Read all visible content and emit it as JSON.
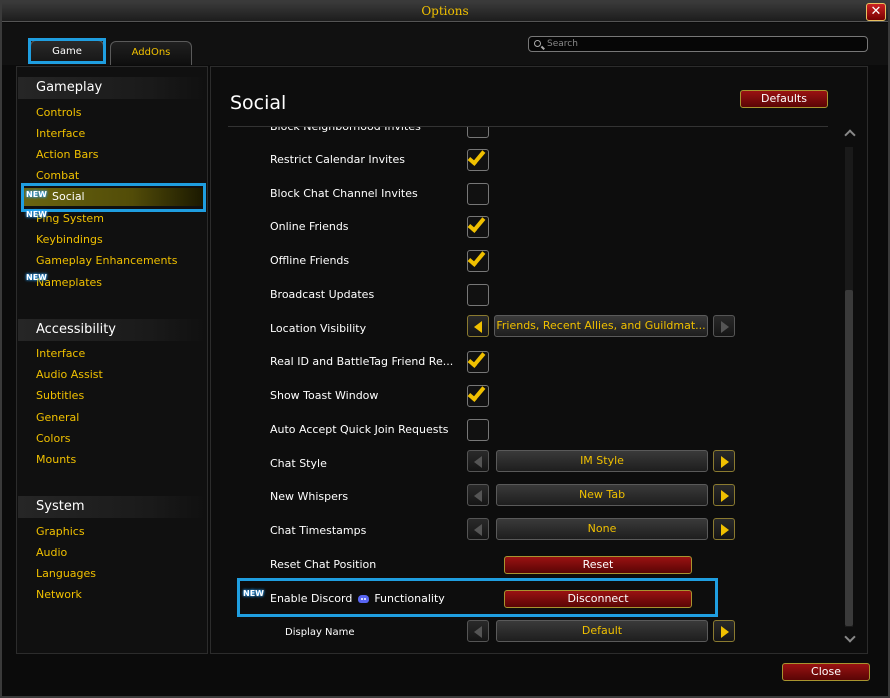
{
  "window": {
    "title": "Options"
  },
  "tabs": [
    {
      "label": "Game"
    },
    {
      "label": "AddOns"
    }
  ],
  "search": {
    "placeholder": "Search"
  },
  "sidebar": {
    "categories": [
      {
        "title": "Gameplay",
        "items": [
          "Controls",
          "Interface",
          "Action Bars",
          "Combat",
          "Social",
          "Ping System",
          "Keybindings",
          "Gameplay Enhancements",
          "Nameplates"
        ]
      },
      {
        "title": "Accessibility",
        "items": [
          "Interface",
          "Audio Assist",
          "Subtitles",
          "General",
          "Colors",
          "Mounts"
        ]
      },
      {
        "title": "System",
        "items": [
          "Graphics",
          "Audio",
          "Languages",
          "Network"
        ]
      }
    ],
    "new_badge": "NEW"
  },
  "main": {
    "title": "Social",
    "defaults_label": "Defaults",
    "settings": {
      "block_neighborhood": {
        "label": "Block Neighborhood Invites",
        "checked": false
      },
      "restrict_calendar": {
        "label": "Restrict Calendar Invites",
        "checked": true
      },
      "block_chat_channel": {
        "label": "Block Chat Channel Invites",
        "checked": false
      },
      "online_friends": {
        "label": "Online Friends",
        "checked": true
      },
      "offline_friends": {
        "label": "Offline Friends",
        "checked": true
      },
      "broadcast_updates": {
        "label": "Broadcast Updates",
        "checked": false
      },
      "location_visibility": {
        "label": "Location Visibility",
        "value": "Friends, Recent Allies, and Guildmat..."
      },
      "realid_friend_requests": {
        "label": "Real ID and BattleTag Friend Re...",
        "checked": true
      },
      "show_toast": {
        "label": "Show Toast Window",
        "checked": true
      },
      "auto_accept_quick_join": {
        "label": "Auto Accept Quick Join Requests",
        "checked": false
      },
      "chat_style": {
        "label": "Chat Style",
        "value": "IM Style"
      },
      "new_whispers": {
        "label": "New Whispers",
        "value": "New Tab"
      },
      "chat_timestamps": {
        "label": "Chat Timestamps",
        "value": "None"
      },
      "reset_chat_position": {
        "label": "Reset Chat Position",
        "button": "Reset"
      },
      "discord": {
        "label_prefix": "Enable Discord",
        "label_suffix": "Functionality",
        "button": "Disconnect",
        "badge": "NEW"
      },
      "display_name": {
        "label": "Display Name",
        "value": "Default"
      }
    }
  },
  "footer": {
    "close_label": "Close"
  },
  "colors": {
    "accent_gold": "#f0c000",
    "highlight_blue": "#1f9ee0",
    "button_red": "#8b0f0f",
    "discord": "#5865f2"
  }
}
